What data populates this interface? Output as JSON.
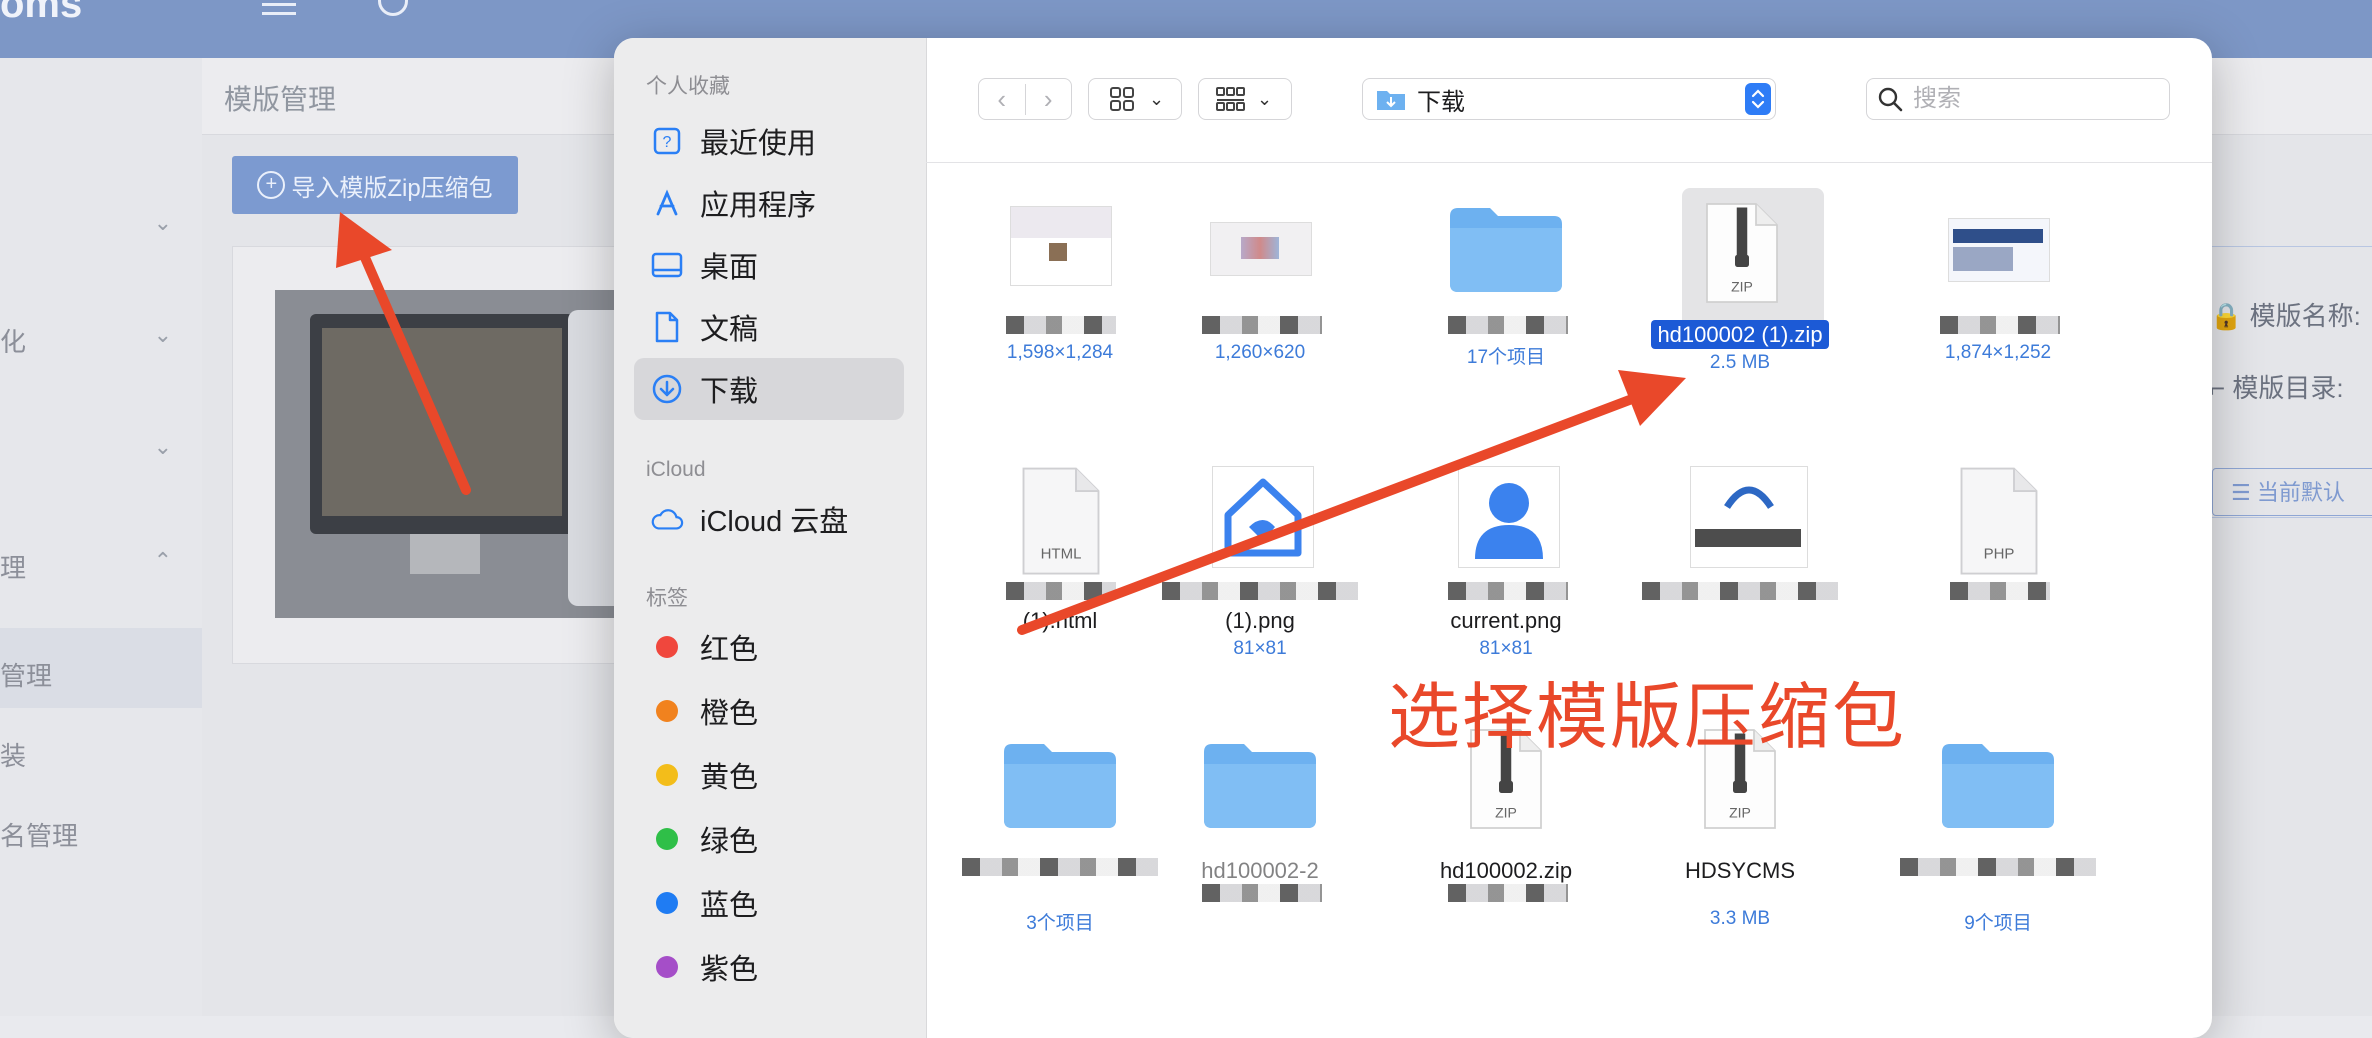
{
  "background": {
    "logo": "oms",
    "breadcrumb": "模版管理",
    "import_button": "导入模版Zip压缩包",
    "sidebar_items": [
      {
        "label": "",
        "chevron": "⌄"
      },
      {
        "label": "化",
        "chevron": "⌄"
      },
      {
        "label": "",
        "chevron": "⌄"
      },
      {
        "label": "理",
        "chevron": "⌃"
      },
      {
        "label": "管理",
        "chevron": ""
      },
      {
        "label": "装",
        "chevron": ""
      },
      {
        "label": "名管理",
        "chevron": ""
      }
    ],
    "right_panel": {
      "template_name": "模版名称:",
      "template_dir": "模版目录:",
      "default_button": "当前默认"
    }
  },
  "dialog": {
    "sidebar": {
      "favorites_title": "个人收藏",
      "favorites": [
        {
          "label": "最近使用",
          "icon": "recents-icon"
        },
        {
          "label": "应用程序",
          "icon": "applications-icon"
        },
        {
          "label": "桌面",
          "icon": "desktop-icon"
        },
        {
          "label": "文稿",
          "icon": "documents-icon"
        },
        {
          "label": "下载",
          "icon": "downloads-icon",
          "selected": true
        }
      ],
      "icloud_title": "iCloud",
      "icloud": [
        {
          "label": "iCloud 云盘",
          "icon": "cloud-icon"
        }
      ],
      "tags_title": "标签",
      "tags": [
        {
          "label": "红色",
          "color": "#f0473d"
        },
        {
          "label": "橙色",
          "color": "#f1821e"
        },
        {
          "label": "黄色",
          "color": "#f3bd1a"
        },
        {
          "label": "绿色",
          "color": "#2fbf48"
        },
        {
          "label": "蓝色",
          "color": "#1f7cf3"
        },
        {
          "label": "紫色",
          "color": "#a54ec8"
        }
      ]
    },
    "toolbar": {
      "location": "下载",
      "search_placeholder": "搜索"
    },
    "files": [
      {
        "name": "",
        "meta": "1,598×1,284",
        "kind": "image"
      },
      {
        "name": "",
        "meta": "1,260×620",
        "kind": "image"
      },
      {
        "name": "",
        "meta": "17个项目",
        "kind": "folder"
      },
      {
        "name": "hd100002 (1).zip",
        "meta": "2.5 MB",
        "kind": "zip",
        "selected": true
      },
      {
        "name": "",
        "meta": "1,874×1,252",
        "kind": "image"
      },
      {
        "name": "(1).html",
        "meta": "",
        "kind": "html"
      },
      {
        "name": "(1).png",
        "meta": "81×81",
        "kind": "png-home"
      },
      {
        "name": "current.png",
        "meta": "81×81",
        "kind": "png-user"
      },
      {
        "name": "",
        "meta": "",
        "kind": "image-logo"
      },
      {
        "name": "",
        "meta": "",
        "kind": "php"
      },
      {
        "name": "",
        "meta": "3个项目",
        "kind": "folder"
      },
      {
        "name": "hd100002-2",
        "meta": "",
        "kind": "folder"
      },
      {
        "name": "hd100002.zip",
        "meta": "",
        "kind": "zip"
      },
      {
        "name": "HDSYCMS",
        "meta": "3.3 MB",
        "kind": "zip"
      },
      {
        "name": "",
        "meta": "9个项目",
        "kind": "folder"
      }
    ]
  },
  "annotation": {
    "text": "选择模版压缩包",
    "color": "#e9482a"
  }
}
